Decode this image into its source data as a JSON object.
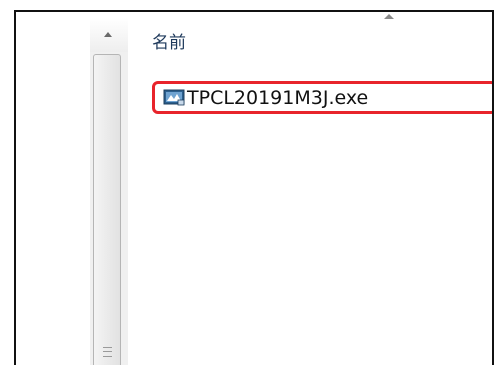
{
  "window": {
    "column_header": "名前",
    "files": [
      {
        "name": "TPCL20191M3J.exe",
        "icon": "installer-exe-icon",
        "highlighted": true,
        "highlight_color": "#e8242b"
      }
    ]
  },
  "scrollbar": {
    "up_icon": "scroll-up-arrow-icon",
    "grip_icon": "scroll-grip-icon"
  },
  "colors": {
    "accent": "#e8242b",
    "header_text": "#1e395b"
  }
}
